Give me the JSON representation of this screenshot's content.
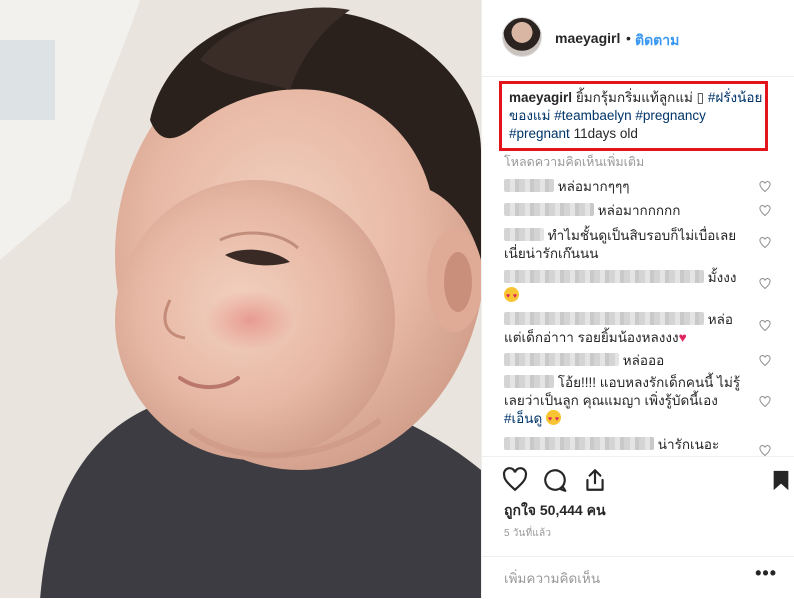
{
  "post": {
    "username": "maeyagirl",
    "follow_separator": "•",
    "follow_label": "ติดตาม"
  },
  "caption": {
    "username": "maeyagirl",
    "text_1": "ยิ้มกรุ้มกริ่มแท้ลูกแม่ ",
    "emoji_placeholder": "▯",
    "tag_1": "#ฝรั่งน้อย",
    "tag_1b": "ของแม่",
    "tag_2": "#teambaelyn",
    "tag_3": "#pregnancy",
    "tag_4": "#pregnant",
    "text_2": " 11days old"
  },
  "load_more": "โหลดความคิดเห็นเพิ่มเติม",
  "comments": [
    {
      "line1": "หล่อมากๆๆๆ"
    },
    {
      "line1": "หล่อมากกกกก"
    },
    {
      "line1": "ทำไมชั้นดูเป็นสิบรอบก็ไม่เบื่อเลย",
      "line2": "เนี่ยน่ารักเก๊นนน"
    },
    {
      "line1": "มั้งงง"
    },
    {
      "line1": "หล่อ",
      "line2": "แต่เด็กอ่าาา รอยยิ้มน้องหลงงง"
    },
    {
      "line1": "หล่อออ"
    },
    {
      "line1": "โอ้ย!!!! แอบหลงรักเด็กคนนี้ ไม่รู้",
      "line2": "เลยว่าเป็นลูก คุณแมญา เพิ่งรู้บัดนี้เอง",
      "line3": "#เอ็นดู"
    },
    {
      "line1": "น่ารักเนอะ"
    }
  ],
  "likes_text": "ถูกใจ 50,444 คน",
  "time_text": "5 วันที่แล้ว",
  "add_comment_placeholder": "เพิ่มความคิดเห็น",
  "more_options": "•••",
  "icons": [
    "heart-icon",
    "comment-icon",
    "share-icon",
    "bookmark-icon"
  ],
  "colors": {
    "link": "#3897f0",
    "highlight_border": "#e3141b",
    "hashtag": "#003569"
  }
}
